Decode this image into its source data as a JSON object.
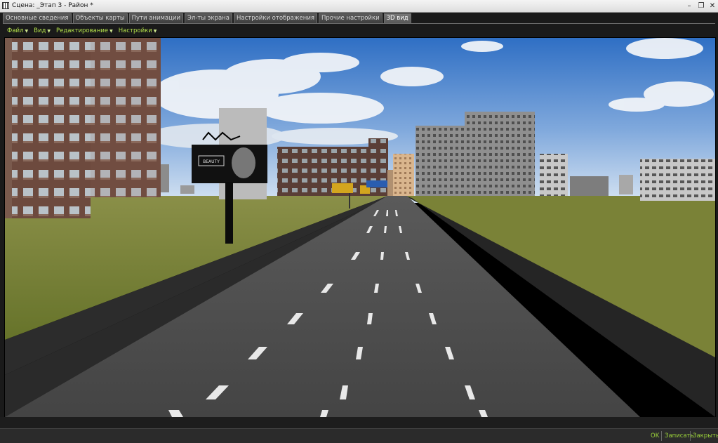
{
  "window": {
    "title": "Сцена: _Этап 3 - Район *",
    "minimize_glyph": "–",
    "restore_glyph": "❐",
    "close_glyph": "✕"
  },
  "tabs": [
    {
      "label": "Основные сведения"
    },
    {
      "label": "Объекты карты"
    },
    {
      "label": "Пути анимации"
    },
    {
      "label": "Эл-ты экрана"
    },
    {
      "label": "Настройки отображения"
    },
    {
      "label": "Прочие настройки"
    },
    {
      "label": "3D вид",
      "active": true
    }
  ],
  "menu": [
    {
      "label": "Файл"
    },
    {
      "label": "Вид"
    },
    {
      "label": "Редактирование"
    },
    {
      "label": "Настройки"
    }
  ],
  "scene": {
    "billboard_text": "BEAUTY",
    "colors": {
      "sky_top": "#3a78c9",
      "sky_bottom": "#cfe0f2",
      "grass": "#6f7d2e",
      "road": "#4a4a4a",
      "curb": "#2a2a2a"
    }
  },
  "footer": {
    "ok_label": "OK",
    "save_label": "Записать",
    "close_label": "Закрыть",
    "accent": "#9bd23a"
  }
}
